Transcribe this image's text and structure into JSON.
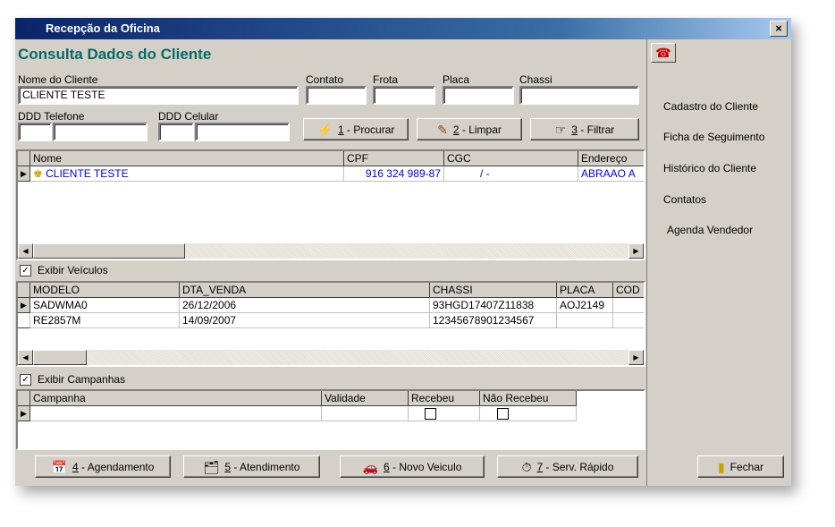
{
  "window": {
    "title": "Recepção da Oficina",
    "close": "×"
  },
  "heading": "Consulta Dados do Cliente",
  "form": {
    "nome_label": "Nome do Cliente",
    "nome_value": "CLIENTE TESTE",
    "contato_label": "Contato",
    "frota_label": "Frota",
    "placa_label": "Placa",
    "chassi_label": "Chassi",
    "ddd_tel_label": "DDD  Telefone",
    "ddd_cel_label": "DDD  Celular"
  },
  "buttons": {
    "procurar_key": "1",
    "procurar_label": " - Procurar",
    "limpar_key": "2",
    "limpar_label": " - Limpar",
    "filtrar_key": "3",
    "filtrar_label": " - Filtrar"
  },
  "clientes_grid": {
    "headers": [
      "Nome",
      "CPF",
      "CGC",
      "Endereço"
    ],
    "row": {
      "nome": "CLIENTE TESTE",
      "cpf": "916 324 989-87",
      "cgc": "/  -",
      "endereco": "ABRAAO A"
    }
  },
  "veiculos": {
    "toggle_label": "Exibir Veículos",
    "checked": true,
    "headers": [
      "MODELO",
      "DTA_VENDA",
      "CHASSI",
      "PLACA",
      "COD"
    ],
    "rows": [
      {
        "modelo": "SADWMA0",
        "dta_venda": "26/12/2006",
        "chassi": "93HGD17407Z11838",
        "placa": "AOJ2149"
      },
      {
        "modelo": "RE2857M",
        "dta_venda": "14/09/2007",
        "chassi": "12345678901234567",
        "placa": ""
      }
    ]
  },
  "campanhas": {
    "toggle_label": "Exibir Campanhas",
    "checked": true,
    "headers": [
      "Campanha",
      "Validade",
      "Recebeu",
      "Não Recebeu"
    ]
  },
  "bottom_buttons": {
    "agendamento_key": "4",
    "agendamento_label": " - Agendamento",
    "atendimento_key": "5",
    "atendimento_label": " - Atendimento",
    "novo_veiculo_key": "6",
    "novo_veiculo_label": " - Novo Veiculo",
    "serv_rapido_key": "7",
    "serv_rapido_label": " - Serv. Rápido",
    "fechar_label": "Fechar"
  },
  "right_menu": [
    "Cadastro do Cliente",
    "Ficha de Seguimento",
    "Histórico do Cliente",
    "Contatos",
    "Agenda Vendedor"
  ],
  "colors": {
    "title_bar": "#0a246a",
    "heading": "#0a6a6a",
    "link_blue": "#0000ff",
    "window_bg": "#d4d0c8"
  }
}
